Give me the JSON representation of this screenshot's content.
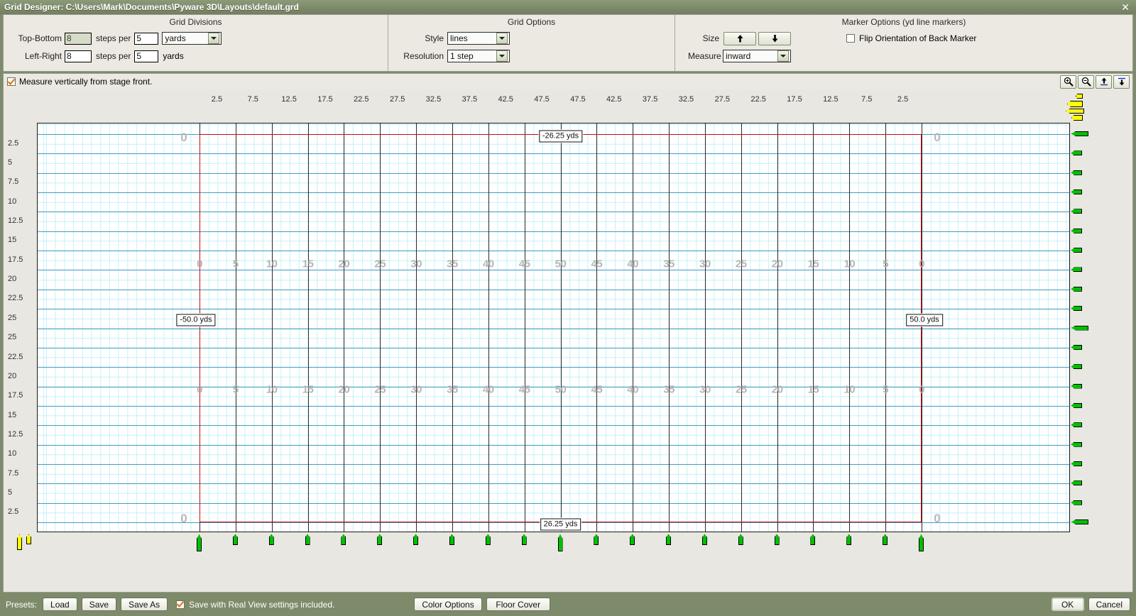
{
  "window": {
    "title": "Grid Designer: C:\\Users\\Mark\\Documents\\Pyware 3D\\Layouts\\default.grd",
    "close_label": "✕"
  },
  "grid_divisions": {
    "panel_title": "Grid Divisions",
    "top_bottom_label": "Top-Bottom",
    "top_bottom_value": "8",
    "top_bottom_steps_label": "steps per",
    "top_bottom_per_value": "5",
    "top_bottom_unit_value": "yards",
    "left_right_label": "Left-Right",
    "left_right_value": "8",
    "left_right_steps_label": "steps per",
    "left_right_per_value": "5",
    "left_right_unit": "yards"
  },
  "grid_options": {
    "panel_title": "Grid Options",
    "style_label": "Style",
    "style_value": "lines",
    "resolution_label": "Resolution",
    "resolution_value": "1 step"
  },
  "marker_options": {
    "panel_title": "Marker Options (yd line markers)",
    "size_label": "Size",
    "size_up": "↑",
    "size_down": "↓",
    "measure_label": "Measure",
    "measure_value": "inward",
    "flip_label": "Flip Orientation of Back Marker",
    "flip_checked": false
  },
  "toolbar": {
    "measure_vertically_label": "Measure vertically from stage front.",
    "measure_vertically_checked": true,
    "buttons": [
      {
        "name": "zoom-in-icon",
        "title": "Zoom In"
      },
      {
        "name": "zoom-out-icon",
        "title": "Zoom Out"
      },
      {
        "name": "move-up-icon",
        "title": "Move Up"
      },
      {
        "name": "move-down-icon",
        "title": "Move Down"
      }
    ]
  },
  "bottom_bar": {
    "presets_label": "Presets:",
    "load_label": "Load",
    "save_label": "Save",
    "save_as_label": "Save As",
    "save_realview_label": "Save with Real View settings included.",
    "save_realview_checked": true,
    "color_options_label": "Color Options",
    "floor_cover_label": "Floor Cover",
    "ok_label": "OK",
    "cancel_label": "Cancel"
  },
  "chart_data": {
    "type": "grid",
    "title": "Marching band field grid layout",
    "x_ticks": [
      "2.5",
      "7.5",
      "12.5",
      "17.5",
      "22.5",
      "27.5",
      "32.5",
      "37.5",
      "42.5",
      "47.5",
      "47.5",
      "42.5",
      "37.5",
      "32.5",
      "27.5",
      "22.5",
      "17.5",
      "12.5",
      "7.5",
      "2.5"
    ],
    "y_ticks": [
      "2.5",
      "5",
      "7.5",
      "10",
      "12.5",
      "15",
      "17.5",
      "20",
      "22.5",
      "25",
      "25",
      "22.5",
      "20",
      "17.5",
      "15",
      "12.5",
      "10",
      "7.5",
      "5",
      "2.5"
    ],
    "yard_numbers": [
      "0",
      "5",
      "10",
      "15",
      "20",
      "25",
      "30",
      "35",
      "40",
      "45",
      "50",
      "45",
      "40",
      "35",
      "30",
      "25",
      "20",
      "15",
      "10",
      "5",
      "0"
    ],
    "corner_numbers": [
      "0",
      "0",
      "0",
      "0"
    ],
    "callouts": [
      {
        "text": "-26.25 yds",
        "position": "top"
      },
      {
        "text": "26.25 yds",
        "position": "bottom"
      },
      {
        "text": "-50.0 yds",
        "position": "left"
      },
      {
        "text": "50.0 yds",
        "position": "right"
      }
    ],
    "colors": {
      "fine_grid": "#c8f0f8",
      "mid_grid": "#4fa3c4",
      "yard_line": "#2b2b2b",
      "boundary": "#d00b0b",
      "marker": "#00c000",
      "marker_preview": "#ffff00"
    },
    "steps_per_5yd_horizontal": 8,
    "steps_per_5yd_vertical": 8
  }
}
